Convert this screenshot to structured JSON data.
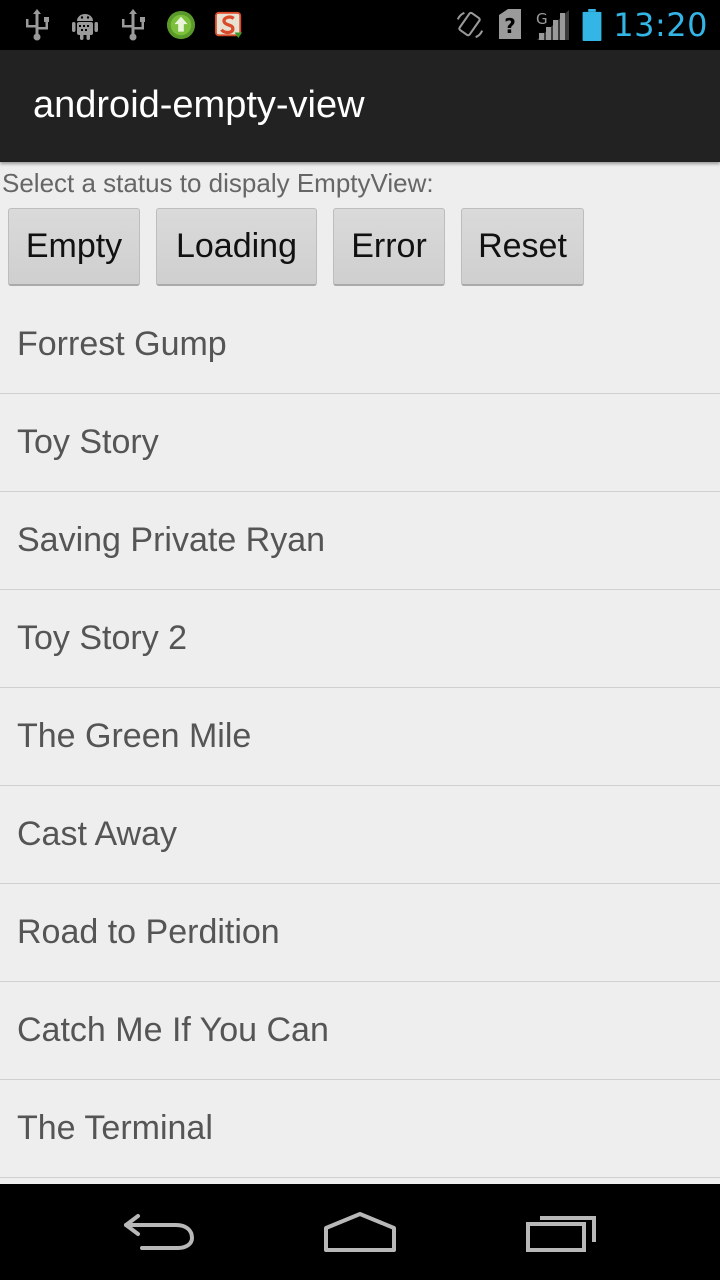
{
  "status_bar": {
    "time": "13:20",
    "left_icons": [
      "usb-icon",
      "android-debug-icon",
      "usb-icon",
      "upload-icon",
      "s-app-icon"
    ],
    "right_icons": [
      "rotate-icon",
      "no-sim-icon",
      "signal-icon",
      "battery-icon"
    ],
    "network_label": "G",
    "accent_color": "#33b5e5"
  },
  "action_bar": {
    "title": "android-empty-view"
  },
  "main": {
    "prompt": "Select a status to dispaly EmptyView:",
    "buttons": {
      "empty": "Empty",
      "loading": "Loading",
      "error": "Error",
      "reset": "Reset"
    },
    "items": [
      "Forrest Gump",
      "Toy Story",
      "Saving Private Ryan",
      "Toy Story 2",
      "The Green Mile",
      "Cast Away",
      "Road to Perdition",
      "Catch Me If You Can",
      "The Terminal"
    ]
  },
  "nav_bar": {
    "icons": [
      "back-icon",
      "home-icon",
      "recent-apps-icon"
    ]
  }
}
